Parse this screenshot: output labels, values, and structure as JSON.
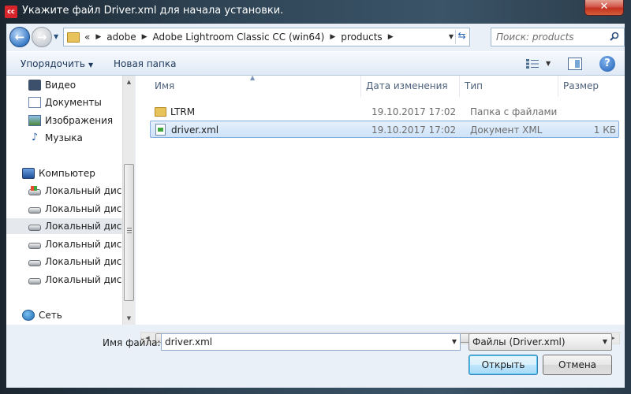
{
  "window": {
    "title": "Укажите файл Driver.xml для начала установки.",
    "close_label": "✕",
    "app_icon_label": "cc"
  },
  "address": {
    "overflow": "«",
    "crumbs": [
      "adobe",
      "Adobe Lightroom Classic CC (win64)",
      "products"
    ]
  },
  "search": {
    "placeholder": "Поиск: products"
  },
  "toolbar": {
    "organize": "Упорядочить",
    "new_folder": "Новая папка"
  },
  "nav": {
    "items": [
      {
        "label": "Видео",
        "icon": "video-icon"
      },
      {
        "label": "Документы",
        "icon": "documents-icon"
      },
      {
        "label": "Изображения",
        "icon": "images-icon"
      },
      {
        "label": "Музыка",
        "icon": "music-icon"
      },
      {
        "label": "Компьютер",
        "icon": "computer-icon"
      },
      {
        "label": "Локальный диск",
        "icon": "system-drive-icon"
      },
      {
        "label": "Локальный диск",
        "icon": "drive-icon"
      },
      {
        "label": "Локальный диск",
        "icon": "drive-icon",
        "selected": true
      },
      {
        "label": "Локальный диск",
        "icon": "drive-icon"
      },
      {
        "label": "Локальный диск",
        "icon": "drive-icon"
      },
      {
        "label": "Локальный диск",
        "icon": "drive-icon"
      },
      {
        "label": "Сеть",
        "icon": "network-icon"
      }
    ]
  },
  "columns": {
    "name": "Имя",
    "date": "Дата изменения",
    "type": "Тип",
    "size": "Размер"
  },
  "files": [
    {
      "name": "LTRM",
      "date": "19.10.2017 17:02",
      "type": "Папка с файлами",
      "size": "",
      "icon": "folder-icon"
    },
    {
      "name": "driver.xml",
      "date": "19.10.2017 17:02",
      "type": "Документ XML",
      "size": "1 КБ",
      "icon": "xml-file-icon",
      "selected": true
    }
  ],
  "bottom": {
    "filename_label": "Имя файла:",
    "filename_value": "driver.xml",
    "filter_value": "Файлы (Driver.xml)",
    "open_label": "Открыть",
    "cancel_label": "Отмена"
  }
}
